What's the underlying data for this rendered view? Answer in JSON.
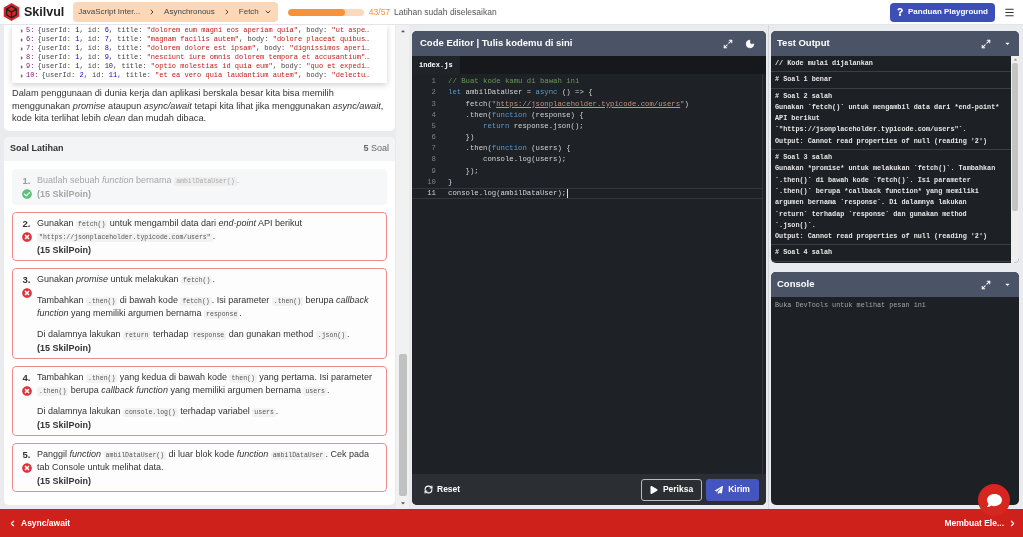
{
  "header": {
    "brand": "Skilvul",
    "breadcrumb": [
      {
        "label": "JavaScript Inter..."
      },
      {
        "label": "Asynchronous"
      },
      {
        "label": "Fetch"
      }
    ],
    "progress": {
      "level": 0.754,
      "count": "43/57",
      "caption": "Latihan sudah diselesaikan"
    },
    "guide_button": "Panduan Playground"
  },
  "lesson": {
    "console_lines": [
      {
        "index": "5:",
        "tokens": [
          {
            "kind": "plain",
            "text": "{userId: "
          },
          {
            "kind": "number",
            "text": "1"
          },
          {
            "kind": "plain",
            "text": ", id: "
          },
          {
            "kind": "number",
            "text": "6"
          },
          {
            "kind": "plain",
            "text": ", title: "
          },
          {
            "kind": "string",
            "text": "\"dolorem eum magni eos aperiam quia\""
          },
          {
            "kind": "plain",
            "text": ", body: "
          },
          {
            "kind": "string",
            "text": "\"ut aspe…"
          }
        ]
      },
      {
        "index": "6:",
        "tokens": [
          {
            "kind": "plain",
            "text": "{userId: "
          },
          {
            "kind": "number",
            "text": "1"
          },
          {
            "kind": "plain",
            "text": ", id: "
          },
          {
            "kind": "number",
            "text": "7"
          },
          {
            "kind": "plain",
            "text": ", title: "
          },
          {
            "kind": "string",
            "text": "\"magnam facilis autem\""
          },
          {
            "kind": "plain",
            "text": ", body: "
          },
          {
            "kind": "string",
            "text": "\"dolore placeat quibus…"
          }
        ]
      },
      {
        "index": "7:",
        "tokens": [
          {
            "kind": "plain",
            "text": "{userId: "
          },
          {
            "kind": "number",
            "text": "1"
          },
          {
            "kind": "plain",
            "text": ", id: "
          },
          {
            "kind": "number",
            "text": "8"
          },
          {
            "kind": "plain",
            "text": ", title: "
          },
          {
            "kind": "string",
            "text": "\"dolorem dolore est ipsam\""
          },
          {
            "kind": "plain",
            "text": ", body: "
          },
          {
            "kind": "string",
            "text": "\"dignissimos aperi…"
          }
        ]
      },
      {
        "index": "8:",
        "tokens": [
          {
            "kind": "plain",
            "text": "{userId: "
          },
          {
            "kind": "number",
            "text": "1"
          },
          {
            "kind": "plain",
            "text": ", id: "
          },
          {
            "kind": "number",
            "text": "9"
          },
          {
            "kind": "plain",
            "text": ", title: "
          },
          {
            "kind": "string",
            "text": "\"nesciunt iure omnis dolorem tempora et accusantium\""
          },
          {
            "kind": "plain",
            "text": "…"
          }
        ]
      },
      {
        "index": "9:",
        "tokens": [
          {
            "kind": "plain",
            "text": "{userId: "
          },
          {
            "kind": "number",
            "text": "1"
          },
          {
            "kind": "plain",
            "text": ", id: "
          },
          {
            "kind": "number",
            "text": "10"
          },
          {
            "kind": "plain",
            "text": ", title: "
          },
          {
            "kind": "string",
            "text": "\"optio molestias id quia eum\""
          },
          {
            "kind": "plain",
            "text": ", body: "
          },
          {
            "kind": "string",
            "text": "\"quo et expedi…"
          }
        ]
      },
      {
        "index": "10:",
        "tokens": [
          {
            "kind": "plain",
            "text": "{userId: "
          },
          {
            "kind": "number",
            "text": "2"
          },
          {
            "kind": "plain",
            "text": ", id: "
          },
          {
            "kind": "number",
            "text": "11"
          },
          {
            "kind": "plain",
            "text": ", title: "
          },
          {
            "kind": "string",
            "text": "\"et ea vero quia laudantium autem\""
          },
          {
            "kind": "plain",
            "text": ", body: "
          },
          {
            "kind": "string",
            "text": "\"delectu…"
          }
        ]
      }
    ],
    "paragraph": "Dalam penggunaan di dunia kerja dan aplikasi berskala besar kita bisa memilih menggunakan *promise* ataupun *async/await* tetapi kita lihat jika menggunakan *async/await*, kode kita terlihat lebih *clean* dan mudah dibaca."
  },
  "exercises": {
    "title": "Soal Latihan",
    "count": "**5** Soal",
    "items": [
      {
        "number": "1.",
        "passed": true,
        "paragraphs": [
          [
            {
              "kind": "text",
              "text": "Buatlah sebuah *function* bernama "
            },
            {
              "kind": "code",
              "text": "ambilDataUser()"
            },
            {
              "kind": "text",
              "text": "."
            }
          ]
        ],
        "points": "(15 SkilPoin)"
      },
      {
        "number": "2.",
        "passed": false,
        "paragraphs": [
          [
            {
              "kind": "text",
              "text": "Gunakan "
            },
            {
              "kind": "code",
              "text": "fetch()"
            },
            {
              "kind": "text",
              "text": " untuk mengambil data dari *end-point* API berikut "
            },
            {
              "kind": "code",
              "text": "\"https://jsonplaceholder.typicode.com/users\""
            },
            {
              "kind": "text",
              "text": "."
            }
          ]
        ],
        "points": "(15 SkilPoin)"
      },
      {
        "number": "3.",
        "passed": false,
        "paragraphs": [
          [
            {
              "kind": "text",
              "text": "Gunakan *promise* untuk melakukan "
            },
            {
              "kind": "code",
              "text": "fetch()"
            },
            {
              "kind": "text",
              "text": "."
            }
          ],
          [
            {
              "kind": "text",
              "text": "Tambahkan "
            },
            {
              "kind": "code",
              "text": ".then()"
            },
            {
              "kind": "text",
              "text": " di bawah kode "
            },
            {
              "kind": "code",
              "text": "fetch()"
            },
            {
              "kind": "text",
              "text": ". Isi parameter "
            },
            {
              "kind": "code",
              "text": ".then()"
            },
            {
              "kind": "text",
              "text": " berupa *callback function* yang memiliki argumen bernama "
            },
            {
              "kind": "code",
              "text": "response"
            },
            {
              "kind": "text",
              "text": "."
            }
          ],
          [
            {
              "kind": "text",
              "text": "Di dalamnya lakukan "
            },
            {
              "kind": "code",
              "text": "return"
            },
            {
              "kind": "text",
              "text": " terhadap "
            },
            {
              "kind": "code",
              "text": "response"
            },
            {
              "kind": "text",
              "text": " dan gunakan method "
            },
            {
              "kind": "code",
              "text": ".json()"
            },
            {
              "kind": "text",
              "text": "."
            }
          ]
        ],
        "points": "(15 SkilPoin)"
      },
      {
        "number": "4.",
        "passed": false,
        "paragraphs": [
          [
            {
              "kind": "text",
              "text": "Tambahkan "
            },
            {
              "kind": "code",
              "text": ".then()"
            },
            {
              "kind": "text",
              "text": " yang kedua di bawah kode "
            },
            {
              "kind": "code",
              "text": "then()"
            },
            {
              "kind": "text",
              "text": " yang pertama. Isi parameter "
            },
            {
              "kind": "code",
              "text": ".then()"
            },
            {
              "kind": "text",
              "text": " berupa *callback function* yang memiliki argumen bernama "
            },
            {
              "kind": "code",
              "text": "users"
            },
            {
              "kind": "text",
              "text": "."
            }
          ],
          [
            {
              "kind": "text",
              "text": "Di dalamnya lakukan "
            },
            {
              "kind": "code",
              "text": "console.log()"
            },
            {
              "kind": "text",
              "text": " terhadap variabel "
            },
            {
              "kind": "code",
              "text": "users"
            },
            {
              "kind": "text",
              "text": "."
            }
          ]
        ],
        "points": "(15 SkilPoin)"
      },
      {
        "number": "5.",
        "passed": false,
        "paragraphs": [
          [
            {
              "kind": "text",
              "text": "Panggil *function* "
            },
            {
              "kind": "code",
              "text": "ambilDataUser()"
            },
            {
              "kind": "text",
              "text": " di luar blok kode *function* "
            },
            {
              "kind": "code",
              "text": "ambilDataUser"
            },
            {
              "kind": "text",
              "text": ". Cek pada tab Console untuk melihat data."
            }
          ]
        ],
        "points": "(15 SkilPoin)"
      }
    ]
  },
  "editor": {
    "title": "Code Editor | Tulis kodemu di sini",
    "file_tab": "index.js",
    "lines": [
      {
        "number": "1",
        "active": false,
        "tokens": [
          {
            "kind": "comment",
            "text": "// Buat kode kamu di bawah ini"
          }
        ]
      },
      {
        "number": "2",
        "active": false,
        "tokens": [
          {
            "kind": "keyword",
            "text": "let"
          },
          {
            "kind": "plain",
            "text": " ambilDataUser = "
          },
          {
            "kind": "keyword",
            "text": "async"
          },
          {
            "kind": "plain",
            "text": " () => {"
          }
        ]
      },
      {
        "number": "3",
        "active": false,
        "tokens": [
          {
            "kind": "plain",
            "text": "    fetch("
          },
          {
            "kind": "string",
            "text": "\""
          },
          {
            "kind": "link",
            "text": "https://jsonplaceholder.typicode.com/users"
          },
          {
            "kind": "string",
            "text": "\""
          },
          {
            "kind": "plain",
            "text": ")"
          }
        ]
      },
      {
        "number": "4",
        "active": false,
        "tokens": [
          {
            "kind": "plain",
            "text": "    .then("
          },
          {
            "kind": "keyword",
            "text": "function"
          },
          {
            "kind": "plain",
            "text": " (response) {"
          }
        ]
      },
      {
        "number": "5",
        "active": false,
        "tokens": [
          {
            "kind": "keyword",
            "text": "        return"
          },
          {
            "kind": "plain",
            "text": " response.json();"
          }
        ]
      },
      {
        "number": "6",
        "active": false,
        "tokens": [
          {
            "kind": "plain",
            "text": "    })"
          }
        ]
      },
      {
        "number": "7",
        "active": false,
        "tokens": [
          {
            "kind": "plain",
            "text": "    .then("
          },
          {
            "kind": "keyword",
            "text": "function"
          },
          {
            "kind": "plain",
            "text": " (users) {"
          }
        ]
      },
      {
        "number": "8",
        "active": false,
        "tokens": [
          {
            "kind": "plain",
            "text": "        console.log(users);"
          }
        ]
      },
      {
        "number": "9",
        "active": false,
        "tokens": [
          {
            "kind": "plain",
            "text": "    });"
          }
        ]
      },
      {
        "number": "10",
        "active": false,
        "tokens": [
          {
            "kind": "plain",
            "text": "}"
          }
        ]
      },
      {
        "number": "11",
        "active": true,
        "tokens": [
          {
            "kind": "plain",
            "text": "console.log(ambilDataUser);"
          }
        ]
      }
    ],
    "buttons": [
      {
        "kind": "reset",
        "label": "Reset"
      },
      {
        "kind": "check",
        "label": "Periksa"
      },
      {
        "kind": "submit",
        "label": "Kirim"
      }
    ]
  },
  "test_output": {
    "title": "Test Output",
    "entries": [
      {
        "heading": "// Kode mulai dijalankan"
      },
      {
        "heading": "# Soal 1 benar"
      },
      {
        "heading": "# Soal 2 salah",
        "message": "Gunakan `fetch()` untuk mengambil data dari *end-point* API berikut `\"https://jsonplaceholder.typicode.com/users\"`.",
        "output": "**Output:** Cannot read properties of null (reading '2')"
      },
      {
        "heading": "# Soal 3 salah",
        "message": "Gunakan *promise* untuk melakukan `fetch()`. Tambahkan `.then()` di bawah kode `fetch()`. Isi parameter `.then()` berupa *callback function* yang memiliki argumen bernama `response`. Di dalamnya lakukan `return` terhadap `response` dan gunakan method `.json()`.",
        "output": "**Output:** Cannot read properties of null (reading '2')"
      },
      {
        "heading": "# Soal 4 salah"
      }
    ]
  },
  "console": {
    "title": "Console",
    "message": "Buka DevTools untuk melihat pesan ini"
  },
  "footer": {
    "previous": "Async/await",
    "next": "Membuat Ele..."
  }
}
